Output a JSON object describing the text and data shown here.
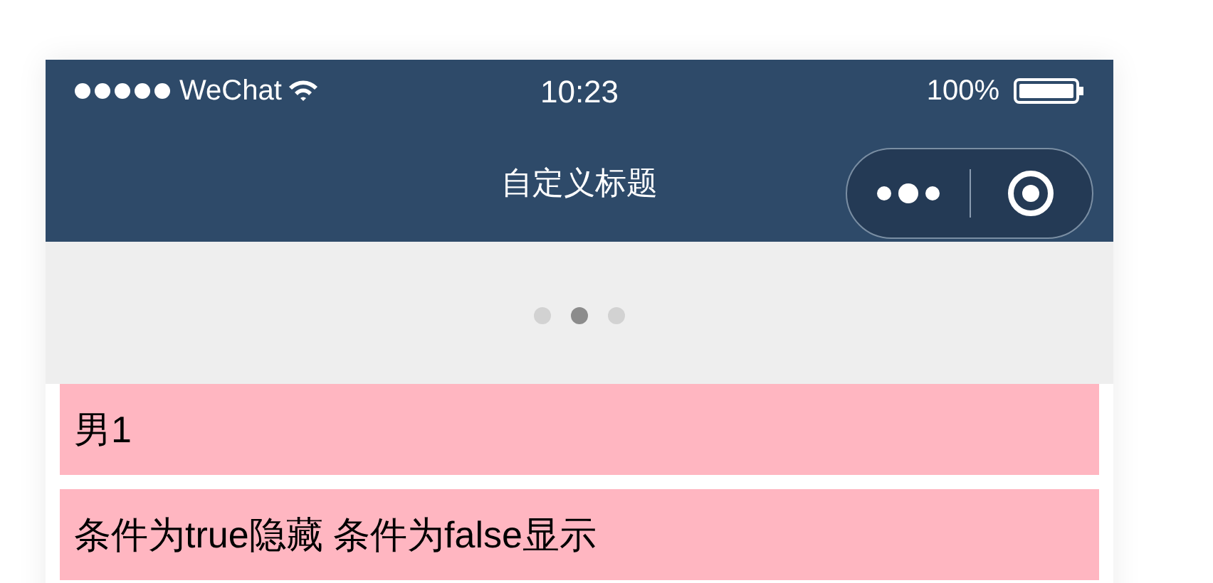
{
  "status_bar": {
    "carrier": "WeChat",
    "time": "10:23",
    "battery": "100%"
  },
  "nav": {
    "title": "自定义标题"
  },
  "swiper": {
    "dots": [
      {
        "selected": false
      },
      {
        "selected": true
      },
      {
        "selected": false
      }
    ]
  },
  "items": [
    {
      "text": "男1"
    },
    {
      "text": "条件为true隐藏 条件为false显示"
    }
  ]
}
